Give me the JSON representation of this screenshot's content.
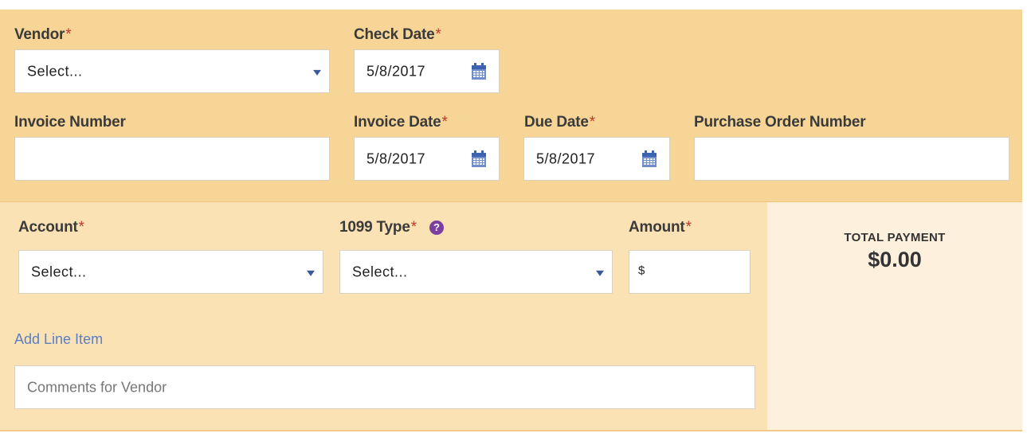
{
  "top_section": {
    "vendor": {
      "label": "Vendor",
      "required_mark": "*",
      "value": "Select..."
    },
    "check_date": {
      "label": "Check Date",
      "required_mark": "*",
      "value": "5/8/2017"
    },
    "invoice_number": {
      "label": "Invoice Number",
      "value": ""
    },
    "invoice_date": {
      "label": "Invoice Date",
      "required_mark": "*",
      "value": "5/8/2017"
    },
    "due_date": {
      "label": "Due Date",
      "required_mark": "*",
      "value": "5/8/2017"
    },
    "purchase_order_number": {
      "label": "Purchase Order Number",
      "value": ""
    }
  },
  "line_item": {
    "account": {
      "label": "Account",
      "required_mark": "*",
      "value": "Select..."
    },
    "type_1099": {
      "label": "1099 Type",
      "required_mark": "*",
      "help_icon": "?",
      "value": "Select..."
    },
    "amount": {
      "label": "Amount",
      "required_mark": "*",
      "prefix": "$",
      "value": ""
    }
  },
  "add_line_item": "Add Line Item",
  "comments": {
    "placeholder": "Comments for Vendor"
  },
  "total_payment": {
    "label": "TOTAL PAYMENT",
    "value": "$0.00"
  },
  "colors": {
    "top_panel": "#f7d597",
    "line_panel": "#fae2b5",
    "total_panel": "#fdf0dd",
    "required": "#c0392b",
    "link": "#5a7fc4",
    "help_icon": "#7b3fa0"
  }
}
